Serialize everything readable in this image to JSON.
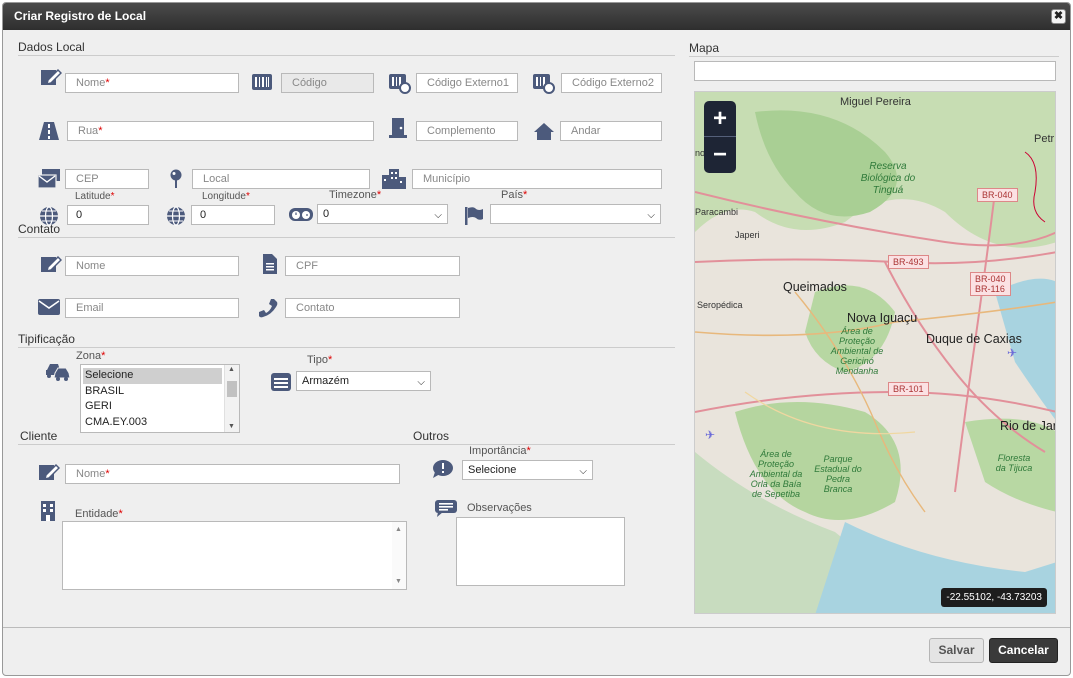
{
  "dialog": {
    "title": "Criar Registro de Local",
    "close_label": "✖"
  },
  "dados_local": {
    "section": "Dados Local",
    "nome": {
      "label": "Nome",
      "req": "*"
    },
    "codigo": {
      "placeholder": "Código"
    },
    "codigo_ext1": {
      "placeholder": "Código Externo1"
    },
    "codigo_ext2": {
      "placeholder": "Código Externo2"
    },
    "rua": {
      "label": "Rua",
      "req": "*"
    },
    "complemento": {
      "placeholder": "Complemento"
    },
    "andar": {
      "placeholder": "Andar"
    },
    "cep": {
      "placeholder": "CEP"
    },
    "local": {
      "placeholder": "Local"
    },
    "municipio": {
      "placeholder": "Município"
    },
    "latitude": {
      "label": "Latitude",
      "req": "*",
      "value": "0"
    },
    "longitude": {
      "label": "Longitude",
      "req": "*",
      "value": "0"
    },
    "timezone": {
      "label": "Timezone",
      "req": "*",
      "value": "0"
    },
    "pais": {
      "label": "País",
      "req": "*",
      "value": ""
    }
  },
  "contato": {
    "section": "Contato",
    "nome": {
      "placeholder": "Nome"
    },
    "cpf": {
      "placeholder": "CPF"
    },
    "email": {
      "placeholder": "Email"
    },
    "contato": {
      "placeholder": "Contato"
    }
  },
  "tipificacao": {
    "section": "Tipificação",
    "zona": {
      "label": "Zona",
      "req": "*",
      "options": [
        "Selecione",
        "BRASIL",
        "GERI",
        "CMA.EY.003"
      ]
    },
    "tipo": {
      "label": "Tipo",
      "req": "*",
      "value": "Armazém"
    }
  },
  "cliente": {
    "section": "Cliente",
    "nome": {
      "label": "Nome",
      "req": "*"
    },
    "entidade": {
      "label": "Entidade",
      "req": "*"
    }
  },
  "outros": {
    "section": "Outros",
    "importancia": {
      "label": "Importância",
      "req": "*",
      "value": "Selecione"
    },
    "observacoes": {
      "label": "Observações"
    }
  },
  "mapa": {
    "section": "Mapa",
    "search_value": "",
    "zoom_in": "+",
    "zoom_out": "−",
    "coords": "-22.55102, -43.73203",
    "places": {
      "miguel_pereira": "Miguel Pereira",
      "petr": "Petr",
      "paracambi": "Paracambi",
      "japeri": "Japeri",
      "seropedica": "Seropédica",
      "queimados": "Queimados",
      "nova_iguacu": "Nova Iguaçu",
      "duque_caxias": "Duque de Caxias",
      "rio": "Rio de Jar",
      "no": "no",
      "reserva": "Reserva Biológica do Tinguá",
      "apa_gericino": "Área de Proteção Ambiental de Gericinó Mendanha",
      "apa_orla": "Área de Proteção Ambiental da Orla da Baía de Sepetiba",
      "parque_pedra": "Parque Estadual do Pedra Branca",
      "floresta_tijuca": "Floresta da Tijuca"
    },
    "roads": {
      "br040": "BR-040",
      "br493": "BR-493",
      "br040_116a": "BR-040",
      "br040_116b": "BR-116",
      "br101": "BR-101"
    }
  },
  "footer": {
    "save": "Salvar",
    "cancel": "Cancelar"
  },
  "colors": {
    "accent": "#4c5a7c",
    "titlebar": "#3a3a3a",
    "required": "#dd0000"
  }
}
